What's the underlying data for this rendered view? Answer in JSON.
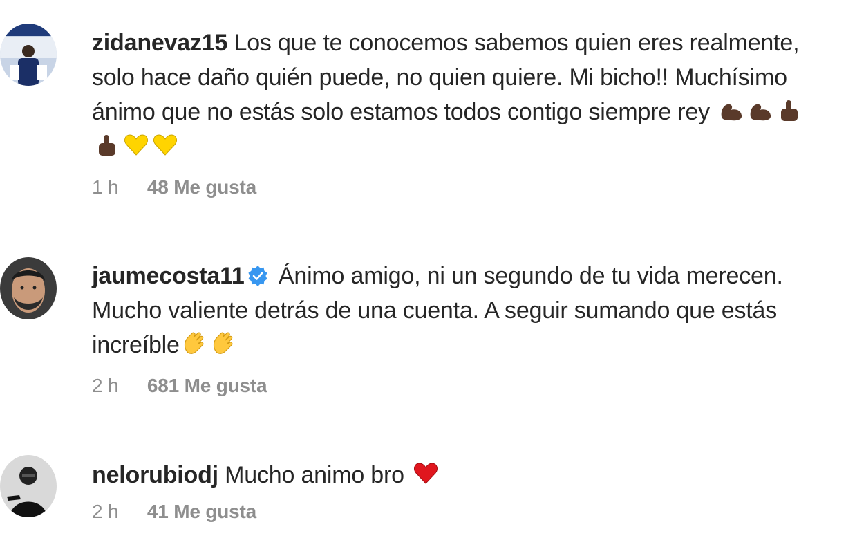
{
  "comments": [
    {
      "username": "zidanevaz15",
      "verified": false,
      "text": "Los que te conocemos sabemos quien eres realmente, solo hace daño quién puede, no quien quiere. Mi bicho!! Muchísimo ánimo que no estás solo estamos todos contigo siempre rey",
      "emojis": [
        "flexed-biceps",
        "flexed-biceps",
        "thumbs",
        "thumbs",
        "yellow-heart",
        "yellow-heart"
      ],
      "time": "1 h",
      "likes": "48 Me gusta"
    },
    {
      "username": "jaumecosta11",
      "verified": true,
      "text": "Ánimo amigo, ni un segundo de tu vida merecen. Mucho valiente detrás de una cuenta. A seguir sumando que estás increíble",
      "emojis": [
        "clapping-hands",
        "clapping-hands"
      ],
      "time": "2 h",
      "likes": "681 Me gusta"
    },
    {
      "username": "nelorubiodj",
      "verified": false,
      "text": "Mucho animo bro",
      "emojis": [
        "red-heart"
      ],
      "time": "2 h",
      "likes": "41 Me gusta"
    }
  ],
  "colors": {
    "text": "#262626",
    "meta": "#8e8e8e",
    "verified": "#3897f0"
  }
}
